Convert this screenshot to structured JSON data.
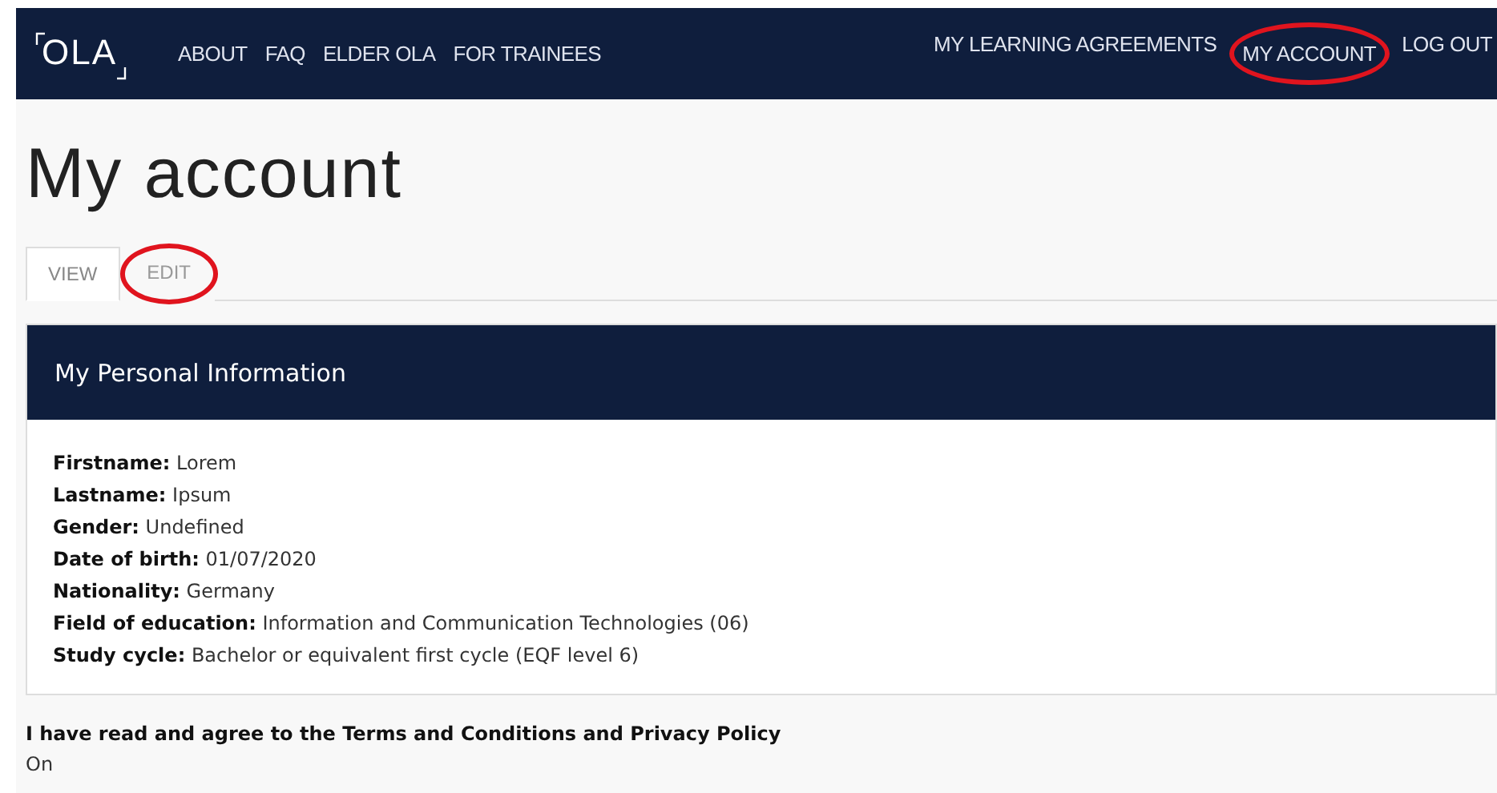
{
  "navbar": {
    "logo": "OLA",
    "left_links": [
      {
        "label": "ABOUT",
        "highlighted": false
      },
      {
        "label": "FAQ",
        "highlighted": false
      },
      {
        "label": "ELDER OLA",
        "highlighted": false
      },
      {
        "label": "FOR TRAINEES",
        "highlighted": false
      }
    ],
    "right_links": [
      {
        "label": "MY LEARNING AGREEMENTS",
        "highlighted": false
      },
      {
        "label": "MY ACCOUNT",
        "highlighted": true
      },
      {
        "label": "LOG OUT",
        "highlighted": false
      }
    ]
  },
  "page_title": "My account",
  "tabs": [
    {
      "label": "VIEW",
      "selected": true,
      "highlighted": false
    },
    {
      "label": "EDIT",
      "selected": false,
      "highlighted": true
    }
  ],
  "panel": {
    "title": "My Personal Information",
    "fields": [
      {
        "label": "Firstname:",
        "value": "Lorem"
      },
      {
        "label": "Lastname:",
        "value": "Ipsum"
      },
      {
        "label": "Gender:",
        "value": "Undefined"
      },
      {
        "label": "Date of birth:",
        "value": "01/07/2020"
      },
      {
        "label": "Nationality:",
        "value": "Germany"
      },
      {
        "label": "Field of education:",
        "value": "Information and Communication Technologies (06)"
      },
      {
        "label": "Study cycle:",
        "value": "Bachelor or equivalent first cycle (EQF level 6)"
      }
    ]
  },
  "terms": {
    "label": "I have read and agree to the Terms and Conditions and Privacy Policy",
    "value": "On"
  }
}
